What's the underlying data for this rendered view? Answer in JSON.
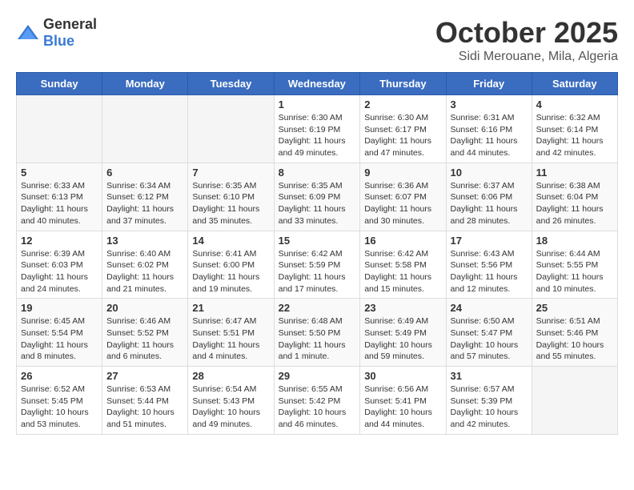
{
  "logo": {
    "general": "General",
    "blue": "Blue"
  },
  "header": {
    "month": "October 2025",
    "location": "Sidi Merouane, Mila, Algeria"
  },
  "days_of_week": [
    "Sunday",
    "Monday",
    "Tuesday",
    "Wednesday",
    "Thursday",
    "Friday",
    "Saturday"
  ],
  "weeks": [
    [
      {
        "day": "",
        "info": ""
      },
      {
        "day": "",
        "info": ""
      },
      {
        "day": "",
        "info": ""
      },
      {
        "day": "1",
        "info": "Sunrise: 6:30 AM\nSunset: 6:19 PM\nDaylight: 11 hours and 49 minutes."
      },
      {
        "day": "2",
        "info": "Sunrise: 6:30 AM\nSunset: 6:17 PM\nDaylight: 11 hours and 47 minutes."
      },
      {
        "day": "3",
        "info": "Sunrise: 6:31 AM\nSunset: 6:16 PM\nDaylight: 11 hours and 44 minutes."
      },
      {
        "day": "4",
        "info": "Sunrise: 6:32 AM\nSunset: 6:14 PM\nDaylight: 11 hours and 42 minutes."
      }
    ],
    [
      {
        "day": "5",
        "info": "Sunrise: 6:33 AM\nSunset: 6:13 PM\nDaylight: 11 hours and 40 minutes."
      },
      {
        "day": "6",
        "info": "Sunrise: 6:34 AM\nSunset: 6:12 PM\nDaylight: 11 hours and 37 minutes."
      },
      {
        "day": "7",
        "info": "Sunrise: 6:35 AM\nSunset: 6:10 PM\nDaylight: 11 hours and 35 minutes."
      },
      {
        "day": "8",
        "info": "Sunrise: 6:35 AM\nSunset: 6:09 PM\nDaylight: 11 hours and 33 minutes."
      },
      {
        "day": "9",
        "info": "Sunrise: 6:36 AM\nSunset: 6:07 PM\nDaylight: 11 hours and 30 minutes."
      },
      {
        "day": "10",
        "info": "Sunrise: 6:37 AM\nSunset: 6:06 PM\nDaylight: 11 hours and 28 minutes."
      },
      {
        "day": "11",
        "info": "Sunrise: 6:38 AM\nSunset: 6:04 PM\nDaylight: 11 hours and 26 minutes."
      }
    ],
    [
      {
        "day": "12",
        "info": "Sunrise: 6:39 AM\nSunset: 6:03 PM\nDaylight: 11 hours and 24 minutes."
      },
      {
        "day": "13",
        "info": "Sunrise: 6:40 AM\nSunset: 6:02 PM\nDaylight: 11 hours and 21 minutes."
      },
      {
        "day": "14",
        "info": "Sunrise: 6:41 AM\nSunset: 6:00 PM\nDaylight: 11 hours and 19 minutes."
      },
      {
        "day": "15",
        "info": "Sunrise: 6:42 AM\nSunset: 5:59 PM\nDaylight: 11 hours and 17 minutes."
      },
      {
        "day": "16",
        "info": "Sunrise: 6:42 AM\nSunset: 5:58 PM\nDaylight: 11 hours and 15 minutes."
      },
      {
        "day": "17",
        "info": "Sunrise: 6:43 AM\nSunset: 5:56 PM\nDaylight: 11 hours and 12 minutes."
      },
      {
        "day": "18",
        "info": "Sunrise: 6:44 AM\nSunset: 5:55 PM\nDaylight: 11 hours and 10 minutes."
      }
    ],
    [
      {
        "day": "19",
        "info": "Sunrise: 6:45 AM\nSunset: 5:54 PM\nDaylight: 11 hours and 8 minutes."
      },
      {
        "day": "20",
        "info": "Sunrise: 6:46 AM\nSunset: 5:52 PM\nDaylight: 11 hours and 6 minutes."
      },
      {
        "day": "21",
        "info": "Sunrise: 6:47 AM\nSunset: 5:51 PM\nDaylight: 11 hours and 4 minutes."
      },
      {
        "day": "22",
        "info": "Sunrise: 6:48 AM\nSunset: 5:50 PM\nDaylight: 11 hours and 1 minute."
      },
      {
        "day": "23",
        "info": "Sunrise: 6:49 AM\nSunset: 5:49 PM\nDaylight: 10 hours and 59 minutes."
      },
      {
        "day": "24",
        "info": "Sunrise: 6:50 AM\nSunset: 5:47 PM\nDaylight: 10 hours and 57 minutes."
      },
      {
        "day": "25",
        "info": "Sunrise: 6:51 AM\nSunset: 5:46 PM\nDaylight: 10 hours and 55 minutes."
      }
    ],
    [
      {
        "day": "26",
        "info": "Sunrise: 6:52 AM\nSunset: 5:45 PM\nDaylight: 10 hours and 53 minutes."
      },
      {
        "day": "27",
        "info": "Sunrise: 6:53 AM\nSunset: 5:44 PM\nDaylight: 10 hours and 51 minutes."
      },
      {
        "day": "28",
        "info": "Sunrise: 6:54 AM\nSunset: 5:43 PM\nDaylight: 10 hours and 49 minutes."
      },
      {
        "day": "29",
        "info": "Sunrise: 6:55 AM\nSunset: 5:42 PM\nDaylight: 10 hours and 46 minutes."
      },
      {
        "day": "30",
        "info": "Sunrise: 6:56 AM\nSunset: 5:41 PM\nDaylight: 10 hours and 44 minutes."
      },
      {
        "day": "31",
        "info": "Sunrise: 6:57 AM\nSunset: 5:39 PM\nDaylight: 10 hours and 42 minutes."
      },
      {
        "day": "",
        "info": ""
      }
    ]
  ]
}
